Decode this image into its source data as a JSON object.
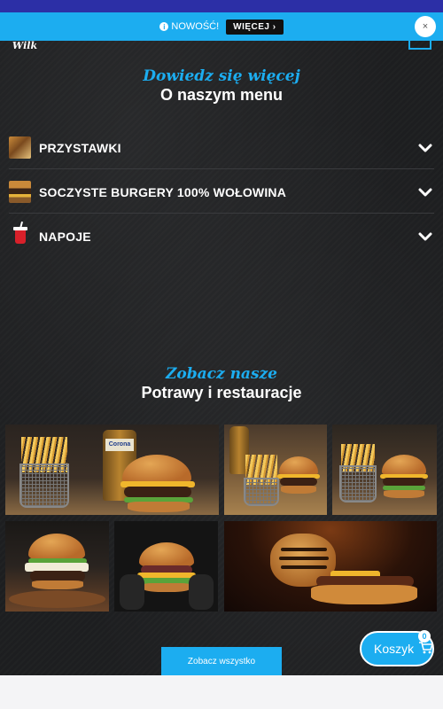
{
  "notice": {
    "label": "NOWOŚĆ!",
    "button": "WIĘCEJ ›",
    "close": "×"
  },
  "brand": {
    "logo_text": "Wilk"
  },
  "menu_section": {
    "subtitle": "Dowiedz się więcej",
    "title": "O naszym menu",
    "items": [
      {
        "label": "PRZYSTAWKI",
        "icon": "fries-thumbnail"
      },
      {
        "label": "SOCZYSTE BURGERY 100% WOŁOWINA",
        "icon": "burger-thumbnail"
      },
      {
        "label": "NAPOJE",
        "icon": "drink-cup-icon"
      }
    ]
  },
  "gallery_section": {
    "subtitle": "Zobacz nasze",
    "title": "Potrawy i restauracje",
    "bottle_label": "Corona"
  },
  "see_all_button": "Zobacz wszystko",
  "cart": {
    "label": "Koszyk",
    "count": "0"
  },
  "colors": {
    "accent": "#1cadf0",
    "background": "#1d1e20",
    "top_strip": "#2c2fa6"
  }
}
